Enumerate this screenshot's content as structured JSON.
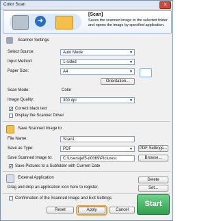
{
  "window": {
    "title": "Color Scan",
    "close_glyph": "✕"
  },
  "banner": {
    "title": "[Scan]",
    "description": "Saves the scanned image to the selected folder and opens the image by specified application.",
    "icons": [
      "scanner-icon",
      "arrow-right-icon",
      "folder-icon"
    ]
  },
  "scanner_settings": {
    "heading": "Scanner Settings",
    "select_source_label": "Select Source:",
    "select_source_value": "Auto Mode",
    "input_method_label": "Input Method:",
    "input_method_value": "1-sided",
    "paper_size_label": "Paper Size:",
    "paper_size_value": "A4",
    "orientation_button": "Orientation...",
    "scan_mode_label": "Scan Mode:",
    "scan_mode_value": "Color",
    "image_quality_label": "Image Quality:",
    "image_quality_value": "300 dpi",
    "correct_black_text": {
      "label": "Correct black text",
      "checked": true
    },
    "display_scanner_driver": {
      "label": "Display the Scanner Driver",
      "checked": false
    }
  },
  "save_section": {
    "heading": "Save Scanned Image to",
    "file_name_label": "File Name:",
    "file_name_value": "Scan1",
    "save_as_type_label": "Save as Type:",
    "save_as_type_value": "PDF",
    "pdf_settings_button": "PDF Settings...",
    "save_to_label": "Save Scanned Image to:",
    "save_to_value": "C:\\Users\\jef5-d0069\\Pictures\\",
    "browse_button": "Browse...",
    "subfolder": {
      "label": "Save Pictures to a Subfolder with Current Date",
      "checked": true
    }
  },
  "external_app": {
    "heading": "External Application",
    "delete_button": "Delete",
    "hint": "Drag and drop an application icon here to register.",
    "set_button": "Set..."
  },
  "footer": {
    "confirmation": {
      "label": "Confirmation of the Scanned Image and Exit Settings",
      "checked": false
    },
    "reset_button": "Reset",
    "apply_button": "Apply",
    "cancel_button": "Cancel",
    "start_button": "Start",
    "check_glyph": "✓",
    "dropdown_glyph": "▼"
  }
}
